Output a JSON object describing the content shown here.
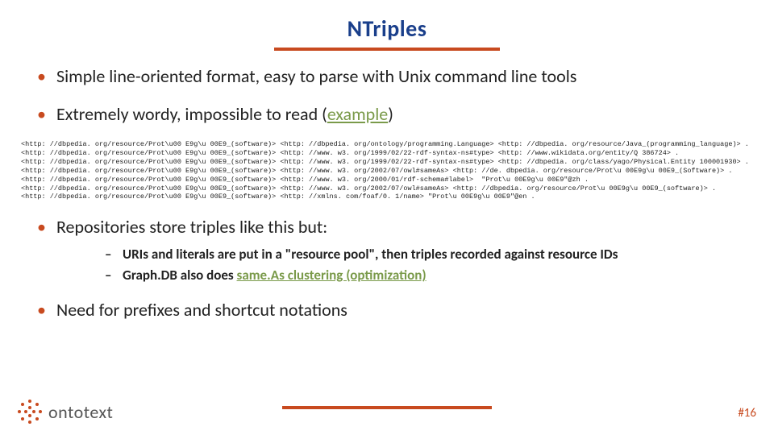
{
  "title": "NTriples",
  "bullets": {
    "b1": "Simple line-oriented format, easy to parse with Unix command line tools",
    "b2_pre": "Extremely wordy, impossible to read (",
    "b2_link": "example",
    "b2_post": ")",
    "b3": "Repositories store triples like this but:",
    "b3_sub1_pre": "URIs and literals are put in a \"resource pool\", then triples recorded against resource IDs",
    "b3_sub2_pre": "Graph.DB also does ",
    "b3_sub2_link": "same.As clustering (optimization)",
    "b4": "Need for prefixes and shortcut notations"
  },
  "code": "<http: //dbpedia. org/resource/Prot\\u00 E9g\\u 00E9_(software)> <http: //dbpedia. org/ontology/programming.Language> <http: //dbpedia. org/resource/Java_(programming_language)> .\n<http: //dbpedia. org/resource/Prot\\u00 E9g\\u 00E9_(software)> <http: //www. w3. org/1999/02/22-rdf-syntax-ns#type> <http: //www.wikidata.org/entity/Q 386724> .\n<http: //dbpedia. org/resource/Prot\\u00 E9g\\u 00E9_(software)> <http: //www. w3. org/1999/02/22-rdf-syntax-ns#type> <http: //dbpedia. org/class/yago/Physical.Entity 100001930> .\n<http: //dbpedia. org/resource/Prot\\u00 E9g\\u 00E9_(software)> <http: //www. w3. org/2002/07/owl#sameAs> <http: //de. dbpedia. org/resource/Prot\\u 00E9g\\u 00E9_(Software)> .\n<http: //dbpedia. org/resource/Prot\\u00 E9g\\u 00E9_(software)> <http: //www. w3. org/2000/01/rdf-schema#label>  \"Prot\\u 00E9g\\u 00E9\"@zh .\n<http: //dbpedia. org/resource/Prot\\u00 E9g\\u 00E9_(software)> <http: //www. w3. org/2002/07/owl#sameAs> <http: //dbpedia. org/resource/Prot\\u 00E9g\\u 00E9_(software)> .\n<http: //dbpedia. org/resource/Prot\\u00 E9g\\u 00E9_(software)> <http: //xmlns. com/foaf/0. 1/name> \"Prot\\u 00E9g\\u 00E9\"@en .",
  "logo_text": "ontotext",
  "page_num": "#16"
}
